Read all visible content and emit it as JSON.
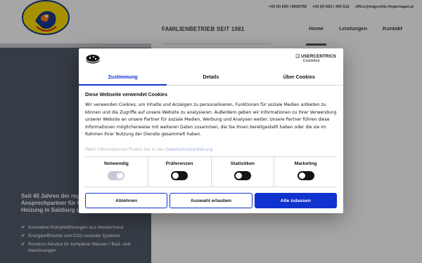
{
  "site": {
    "logo_text": "Migschitz · Fingernagel",
    "contacts": [
      "+43 (0) 660 / 8639766",
      "+43 (0) 662 / 450 512",
      "office@migschitz-fingernagel.at"
    ],
    "tagline": "FAMILIENBETRIEB SEIT 1981",
    "nav": [
      {
        "label": "Home",
        "active": true
      },
      {
        "label": "Leistungen",
        "active": false
      },
      {
        "label": "Kontakt",
        "active": false
      }
    ],
    "hero_lines": [
      "Seit 40 Jahren der regionale",
      "Ansprechpartner für Gas, Wasser &",
      "Heizung in Salzburg und Umgebung"
    ],
    "bullets": [
      "Innovative Komplettlösungen aus Meisterhand",
      "Energieeffiziente und CO2-neutrale Systeme",
      "Rundum-Service für komplexe Wasser-/ Bad- und Heizlösungen"
    ],
    "check_glyph": "✔"
  },
  "consent": {
    "brand_main": "USERCENTRICS",
    "brand_sub": "Cookiebot",
    "tabs": [
      {
        "label": "Zustimmung",
        "active": true
      },
      {
        "label": "Details",
        "active": false
      },
      {
        "label": "Über Cookies",
        "active": false
      }
    ],
    "title": "Diese Webseite verwendet Cookies",
    "body": "Wir verwenden Cookies, um Inhalte und Anzeigen zu personalisieren, Funktionen für soziale Medien anbieten zu können und die Zugriffe auf unsere Website zu analysieren. Außerdem geben wir Informationen zu Ihrer Verwendung unserer Website an unsere Partner für soziale Medien, Werbung und Analysen weiter. Unsere Partner führen diese Informationen möglicherweise mit weiteren Daten zusammen, die Sie ihnen bereitgestellt haben oder die sie im Rahmen Ihrer Nutzung der Dienste gesammelt haben.",
    "more_prefix": "Mehr Informationen finden Sie in der",
    "more_link": "Datenschutzerklärung",
    "toggles": [
      {
        "label": "Notwendig",
        "state": "on"
      },
      {
        "label": "Präferenzen",
        "state": "off"
      },
      {
        "label": "Statistiken",
        "state": "off"
      },
      {
        "label": "Marketing",
        "state": "off"
      }
    ],
    "buttons": {
      "decline": "Ablehnen",
      "allow_selection": "Auswahl erlauben",
      "allow_all": "Alle zulassen"
    }
  },
  "colors": {
    "accent": "#1032cf",
    "panel": "#535c6a"
  }
}
